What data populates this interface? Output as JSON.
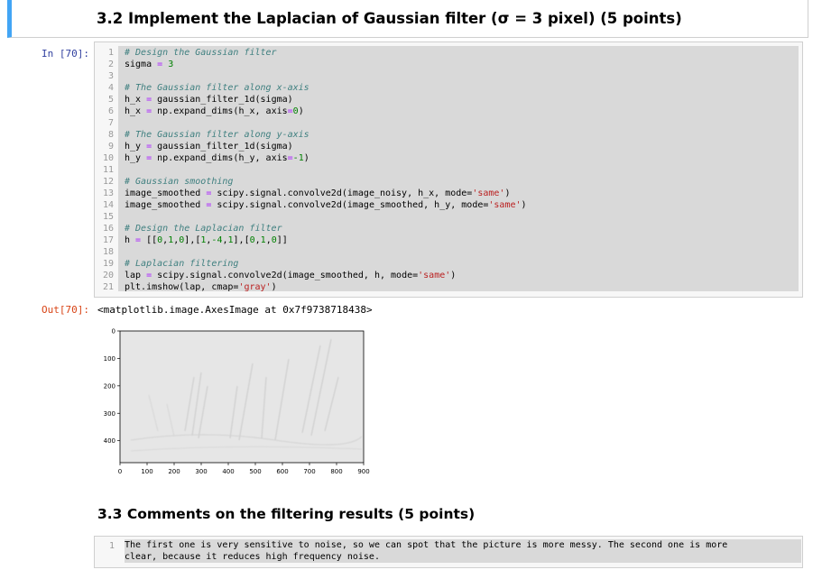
{
  "section_heading": "3.2 Implement the Laplacian of Gaussian filter (σ = 3 pixel) (5 points)",
  "code_cell": {
    "in_prompt": "In [70]:",
    "line_numbers": [
      "1",
      "2",
      "3",
      "4",
      "5",
      "6",
      "7",
      "8",
      "9",
      "10",
      "11",
      "12",
      "13",
      "14",
      "15",
      "16",
      "17",
      "18",
      "19",
      "20",
      "21"
    ],
    "lines": [
      "# Design the Gaussian filter",
      "sigma = 3",
      "",
      "# The Gaussian filter along x-axis",
      "h_x = gaussian_filter_1d(sigma)",
      "h_x = np.expand_dims(h_x, axis=0)",
      "",
      "# The Gaussian filter along y-axis",
      "h_y = gaussian_filter_1d(sigma)",
      "h_y = np.expand_dims(h_y, axis=-1)",
      "",
      "# Gaussian smoothing",
      "image_smoothed = scipy.signal.convolve2d(image_noisy, h_x, mode='same')",
      "image_smoothed = scipy.signal.convolve2d(image_smoothed, h_y, mode='same')",
      "",
      "# Design the Laplacian filter",
      "h = [[0,1,0],[1,-4,1],[0,1,0]]",
      "",
      "# Laplacian filtering",
      "lap = scipy.signal.convolve2d(image_smoothed, h, mode='same')",
      "plt.imshow(lap, cmap='gray')"
    ]
  },
  "output": {
    "out_prompt": "Out[70]:",
    "text": "<matplotlib.image.AxesImage at 0x7f9738718438>"
  },
  "plot": {
    "y_ticks": [
      "0",
      "100",
      "200",
      "300",
      "400"
    ],
    "x_ticks": [
      "0",
      "100",
      "200",
      "300",
      "400",
      "500",
      "600",
      "700",
      "800",
      "900"
    ]
  },
  "comments_heading": "3.3 Comments on the filtering results (5 points)",
  "comment_cell": {
    "line_number": "1",
    "text_line1": "The first one is very sensitive to noise, so we can spot that the picture is more messy. The second one is more",
    "text_line2": "clear, because it reduces high frequency noise."
  },
  "colors": {
    "accent": "#42a5f5",
    "in_prompt": "#303f9f",
    "out_prompt": "#d84315"
  }
}
